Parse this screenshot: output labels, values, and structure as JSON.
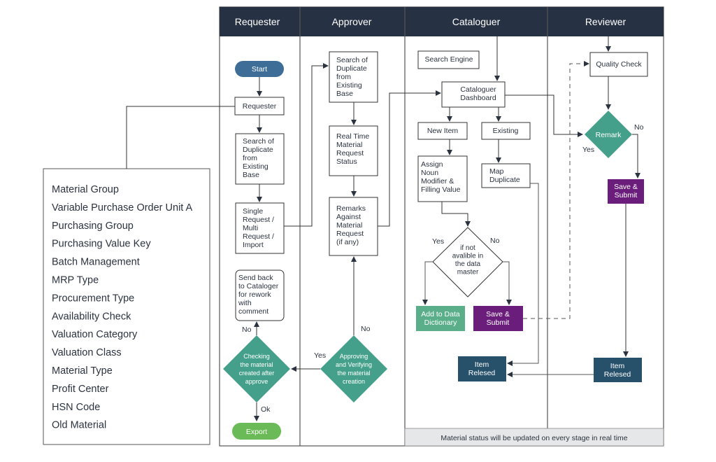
{
  "lanes": [
    {
      "title": "Requester"
    },
    {
      "title": "Approver"
    },
    {
      "title": "Cataloguer"
    },
    {
      "title": "Reviewer"
    }
  ],
  "requester": {
    "start": "Start",
    "requester_box": "Requester",
    "search_duplicate": [
      "Search of",
      "Duplicate",
      "from",
      "Existing",
      "Base"
    ],
    "single_request": [
      "Single",
      "Request /",
      "Multi",
      "Request /",
      "Import"
    ],
    "send_back": [
      "Send back",
      "to Cataloger",
      "for rework",
      "with",
      "comment"
    ],
    "checking_decision": [
      "Checking",
      "the material",
      "created after",
      "approve"
    ],
    "no_label": "No",
    "ok_label": "Ok",
    "export": "Export"
  },
  "approver": {
    "search_duplicate": [
      "Search of",
      "Duplicate",
      "from",
      "Existing",
      "Base"
    ],
    "real_time_status": [
      "Real Time",
      "Material",
      "Request",
      "Status"
    ],
    "remarks": [
      "Remarks",
      "Against",
      "Material",
      "Request",
      "(if any)"
    ],
    "approving_decision": [
      "Approving",
      "and Verifying",
      "the material",
      "creation"
    ],
    "yes_label": "Yes",
    "no_label": "No"
  },
  "cataloguer": {
    "search_engine": "Search Engine",
    "dashboard": [
      "Cataloguer",
      "Dashboard"
    ],
    "new_item": "New Item",
    "existing": "Existing",
    "assign_noun": [
      "Assign",
      "Noun",
      "Modifier &",
      "Filling Value"
    ],
    "map_duplicate": [
      "Map",
      "Duplicate"
    ],
    "availability_decision": [
      "if not",
      "avalible in",
      "the data",
      "master"
    ],
    "yes_label": "Yes",
    "no_label": "No",
    "add_dictionary": [
      "Add to Data",
      "Dictionary"
    ],
    "save_submit": [
      "Save &",
      "Submit"
    ],
    "item_released": [
      "Item",
      "Relesed"
    ]
  },
  "reviewer": {
    "quality_check": "Quality Check",
    "remark_decision": "Remark",
    "yes_label": "Yes",
    "no_label": "No",
    "save_submit": [
      "Save &",
      "Submit"
    ],
    "item_released": [
      "Item",
      "Relesed"
    ]
  },
  "footer": "Material status will be updated on every stage in real time",
  "attribute_list": [
    "Material Group",
    "Variable Purchase Order Unit A",
    "Purchasing Group",
    "Purchasing Value Key",
    "Batch Management",
    "MRP Type",
    "Procurement Type",
    "Availability Check",
    "Valuation Category",
    "Valuation Class",
    "Material Type",
    "Profit Center",
    "HSN Code",
    "Old Material"
  ],
  "colors": {
    "header": "#263244",
    "start": "#3e6d98",
    "decision": "#44a08a",
    "export": "#6abb57",
    "add_dictionary": "#5aaf8a",
    "save_submit": "#6a1d7a",
    "item_released": "#27506b",
    "footer_bg": "#e6e7e8",
    "line": "#4a5565"
  }
}
